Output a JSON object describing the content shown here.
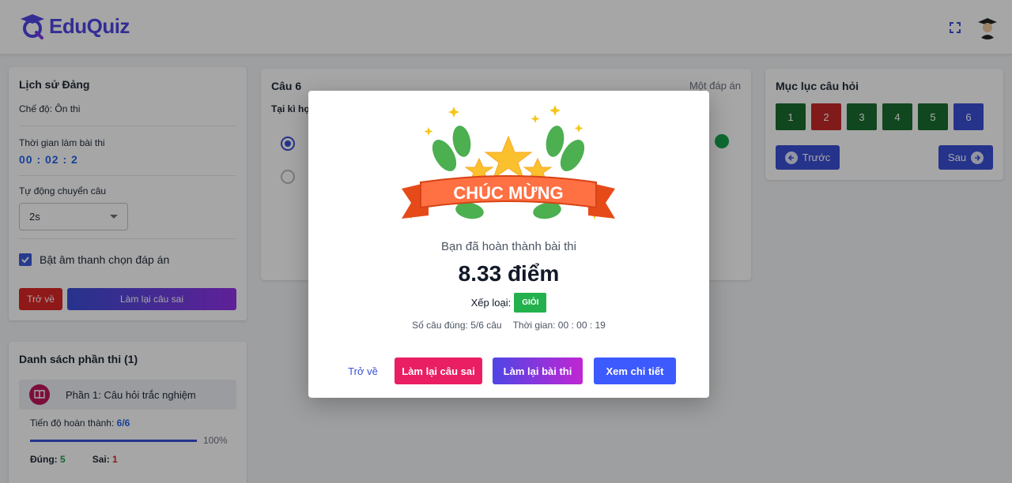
{
  "app": {
    "name": "EduQuiz"
  },
  "header": {
    "fullscreen_icon": "fullscreen-icon",
    "avatar_icon": "graduate-avatar"
  },
  "left_panel": {
    "subject": "Lịch sử Đảng",
    "mode": "Chế độ: Ôn thi",
    "time_label": "Thời gian làm bài thi",
    "time_value": "00 : 02 : 2",
    "auto_next_label": "Tự động chuyển câu",
    "auto_next_value": "2s",
    "sound_label": "Bật âm thanh chọn đáp án",
    "sound_checked": true,
    "back_label": "Trở về",
    "retry_wrong_label": "Làm lại câu sai"
  },
  "sections": {
    "title": "Danh sách phần thi (1)",
    "items": [
      {
        "label": "Phần 1: Câu hỏi trắc nghiệm",
        "progress_label": "Tiến độ hoàn thành:",
        "progress_value": "6/6",
        "progress_fraction": 1.0,
        "progress_pct": "100%",
        "correct_label": "Đúng:",
        "correct_value": "5",
        "wrong_label": "Sai:",
        "wrong_value": "1"
      }
    ]
  },
  "question": {
    "number_label": "Câu 6",
    "type_label": "Một đáp án",
    "text": "Tại kì họ"
  },
  "index": {
    "title": "Mục lục câu hỏi",
    "numbers": [
      {
        "label": "1",
        "color": "#1b6e2f"
      },
      {
        "label": "2",
        "color": "#c62828"
      },
      {
        "label": "3",
        "color": "#1b6e2f"
      },
      {
        "label": "4",
        "color": "#1b6e2f"
      },
      {
        "label": "5",
        "color": "#1b6e2f"
      },
      {
        "label": "6",
        "color": "#3b4fd6"
      }
    ],
    "prev_label": "Trước",
    "next_label": "Sau"
  },
  "modal": {
    "banner_text": "CHÚC MỪNG",
    "subtitle": "Bạn đã hoàn thành bài thi",
    "score": "8.33 điểm",
    "rank_label": "Xếp loại:",
    "rank_value": "GIỎI",
    "correct_count": "Số câu đúng: 5/6 câu",
    "time_spent": "Thời gian: 00 : 00 : 19",
    "back_label": "Trở về",
    "retry_wrong_label": "Làm lại câu sai",
    "redo_label": "Làm lại bài thi",
    "detail_label": "Xem chi tiết"
  },
  "colors": {
    "brand": "#4f46e5",
    "danger": "#dc2626",
    "success": "#16a34a",
    "primary": "#3b4fd6",
    "pink": "#e91e63"
  }
}
